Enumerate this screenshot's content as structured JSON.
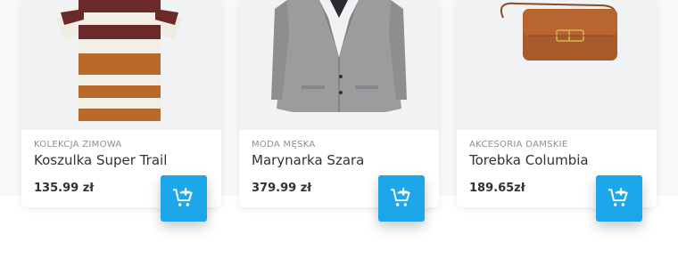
{
  "products": [
    {
      "category": "KOLEKCJA ZIMOWA",
      "name": "Koszulka Super Trail",
      "price": "135.99 zł",
      "image_icon": "striped-tshirt-image"
    },
    {
      "category": "MODA MĘSKA",
      "name": "Marynarka Szara",
      "price": "379.99 zł",
      "image_icon": "grey-blazer-image"
    },
    {
      "category": "AKCESORIA DAMSKIE",
      "name": "Torebka Columbia",
      "price": "189.65zł",
      "image_icon": "brown-handbag-image"
    }
  ],
  "cart_button_icon": "add-to-cart-icon",
  "colors": {
    "accent": "#1ea6ea",
    "text": "#2f3237",
    "muted": "#8b8f96"
  }
}
